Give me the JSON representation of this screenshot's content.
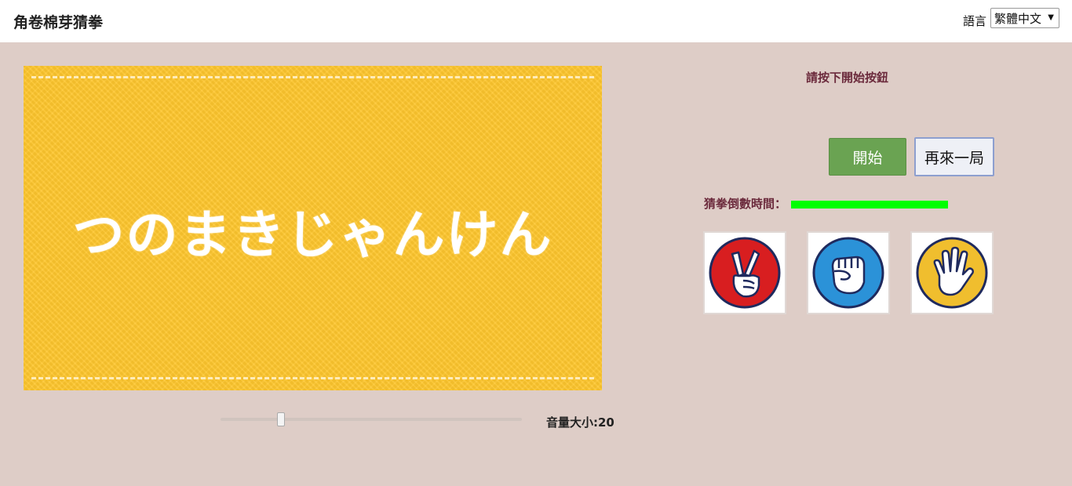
{
  "header": {
    "app_title": "角卷棉芽猜拳",
    "language_label": "語言",
    "language_selected": "繁體中文"
  },
  "banner": {
    "text": "つのまきじゃんけん",
    "background_color": "#fec62d"
  },
  "volume": {
    "label": "音量大小:20",
    "value": 20,
    "max": 100
  },
  "game": {
    "status_message": "請按下開始按鈕",
    "start_button": "開始",
    "again_button": "再來一局",
    "countdown_label": "猜拳倒數時間：",
    "countdown_fraction": 1.0,
    "countdown_color": "#00ff00"
  },
  "hands": [
    {
      "name": "scissors",
      "icon": "scissors-hand-icon",
      "color": "#d81e20"
    },
    {
      "name": "rock",
      "icon": "rock-fist-icon",
      "color": "#2b92d8"
    },
    {
      "name": "paper",
      "icon": "paper-hand-icon",
      "color": "#f0be2e"
    }
  ]
}
